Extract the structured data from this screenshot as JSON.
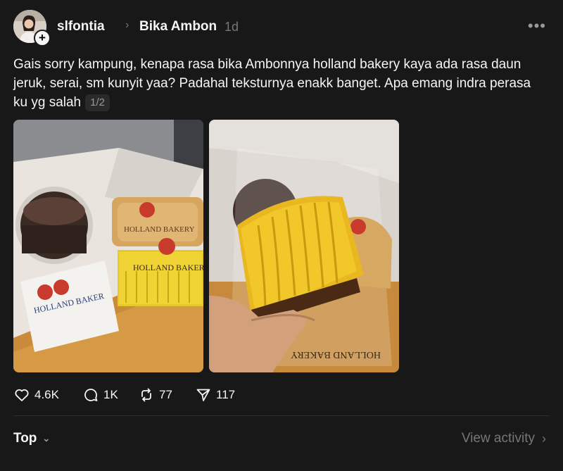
{
  "post": {
    "author": "slfontia",
    "separator": "›",
    "community": "Bika Ambon",
    "timestamp": "1d",
    "more_label": "•••",
    "text": "Gais sorry kampung, kenapa rasa bika Ambonnya holland bakery kaya ada rasa daun jeruk, serai, sm kunyit yaa? Padahal teksturnya enakk banget. Apa emang indra perasa ku yg salah",
    "image_counter": "1/2",
    "images": [
      {
        "packaging_text": "HOLLAND BAKERY"
      },
      {
        "packaging_text": "HOLLAND BAKERY"
      }
    ]
  },
  "actions": {
    "likes": "4.6K",
    "replies": "1K",
    "reposts": "77",
    "shares": "117"
  },
  "footer": {
    "sort_label": "Top",
    "view_activity_label": "View activity"
  },
  "colors": {
    "background": "#181818",
    "text": "#f3f5f7",
    "muted": "#777777"
  }
}
